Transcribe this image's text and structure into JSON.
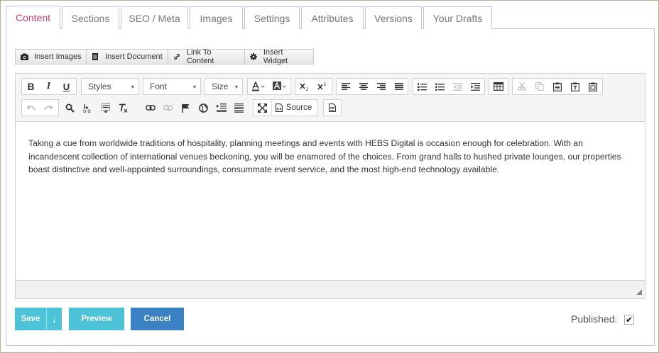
{
  "tabs": [
    {
      "label": "Content",
      "active": true
    },
    {
      "label": "Sections"
    },
    {
      "label": "SEO / Meta"
    },
    {
      "label": "Images"
    },
    {
      "label": "Settings"
    },
    {
      "label": "Attributes"
    },
    {
      "label": "Versions"
    },
    {
      "label": "Your Drafts"
    }
  ],
  "insert_toolbar": {
    "images": "Insert Images",
    "document": "Insert Document",
    "link": "Link To Content",
    "widget": "Insert Widget"
  },
  "editor": {
    "bold": "B",
    "italic": "I",
    "underline": "U",
    "styles": "Styles",
    "font": "Font",
    "size": "Size",
    "source": "Source",
    "content": "Taking a cue from worldwide traditions of hospitality, planning meetings and events with HEBS Digital is occasion enough for celebration. With an incandescent collection of international venues beckoning, you will be enamored of the choices. From grand halls to hushed private lounges, our properties boast distinctive and well-appointed surroundings, consummate event service, and the most high-end technology available."
  },
  "actions": {
    "save": "Save",
    "save_more": "↓",
    "preview": "Preview",
    "cancel": "Cancel"
  },
  "published": {
    "label": "Published:",
    "checked": true,
    "mark": "✔"
  },
  "colors": {
    "active_tab": "#c8416b",
    "primary": "#4cc3d7",
    "cancel": "#3b82c4"
  }
}
